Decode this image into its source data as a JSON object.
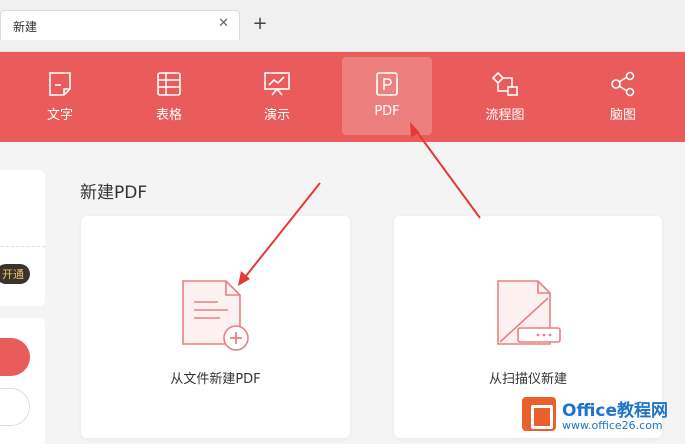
{
  "tab": {
    "title": "新建",
    "close": "✕",
    "new": "+"
  },
  "toolbar": {
    "items": [
      {
        "label": "文字"
      },
      {
        "label": "表格"
      },
      {
        "label": "演示"
      },
      {
        "label": "PDF"
      },
      {
        "label": "流程图"
      },
      {
        "label": "脑图"
      }
    ],
    "active_index": 3,
    "bg_color": "#ea5c5c"
  },
  "left": {
    "open_label": "开通"
  },
  "section": {
    "title": "新建PDF"
  },
  "cards": [
    {
      "label": "从文件新建PDF",
      "icon": "file-add-icon"
    },
    {
      "label": "从扫描仪新建",
      "icon": "scanner-file-icon"
    }
  ],
  "watermark": {
    "brand": "Office教程网",
    "url": "www.office26.com"
  }
}
